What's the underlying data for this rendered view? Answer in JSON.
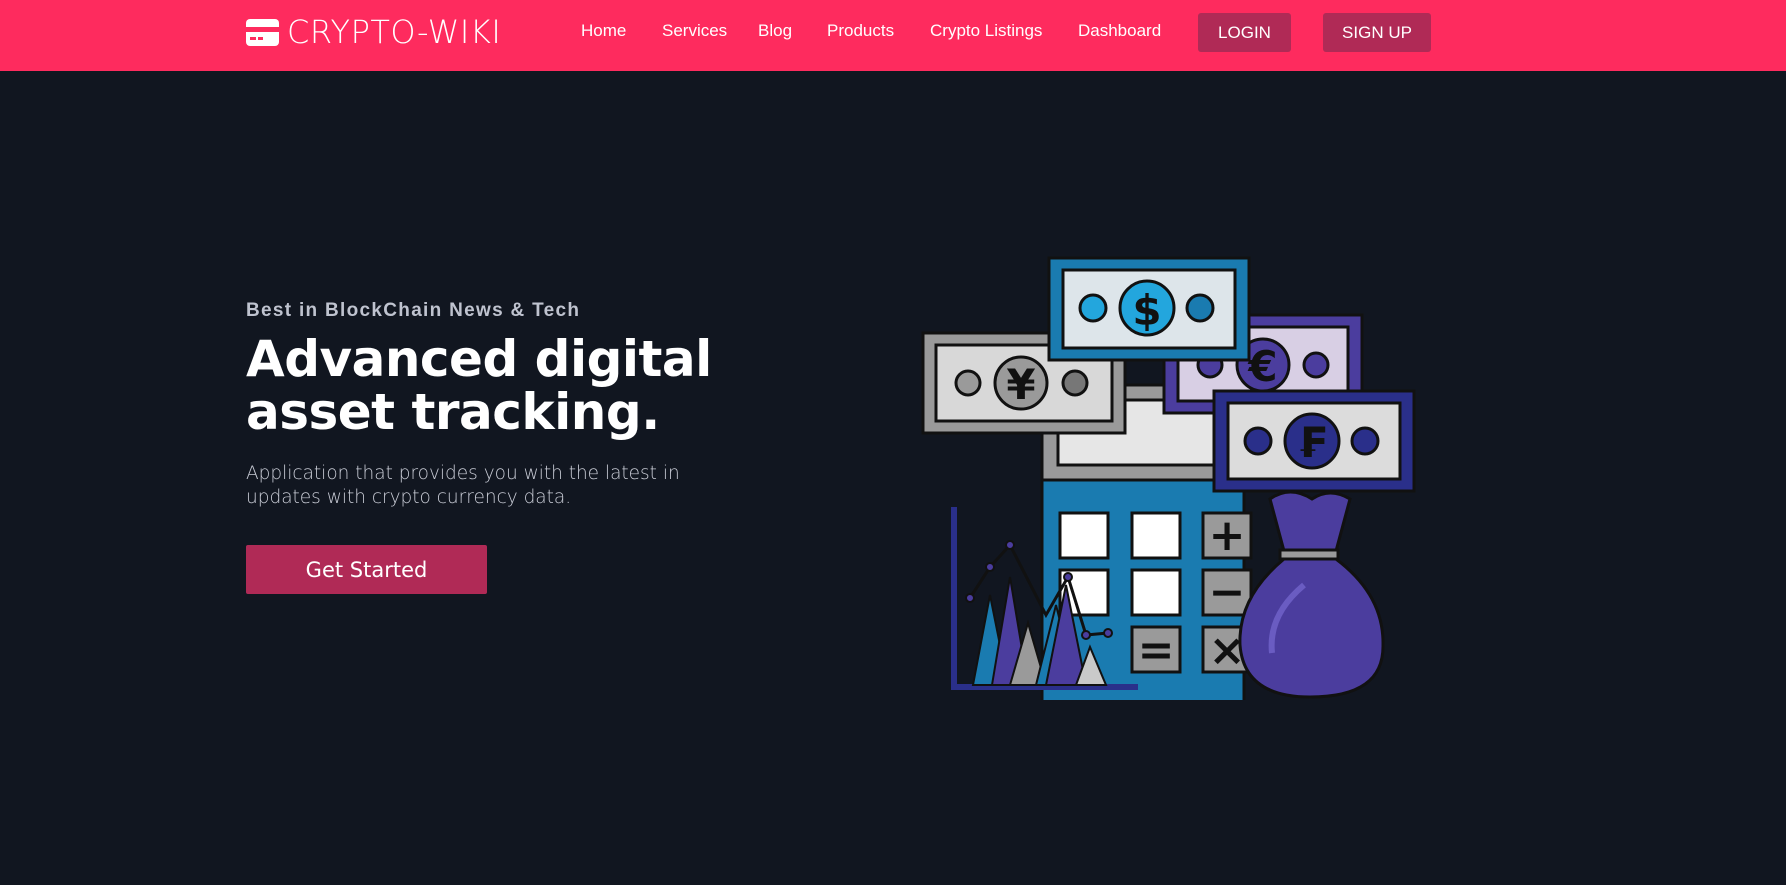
{
  "nav": {
    "brand": "CRYPTO-WIKI",
    "links": [
      "Home",
      "Services",
      "Blog",
      "Products",
      "Crypto Listings",
      "Dashboard"
    ],
    "login_label": "LOGIN",
    "signup_label": "SIGN UP"
  },
  "hero": {
    "eyebrow": "Best in BlockChain News & Tech",
    "headline": "Advanced digital asset tracking.",
    "subtext": "Application that provides you with the latest in updates with crypto currency data.",
    "cta_label": "Get Started"
  },
  "illustration": {
    "currency_symbols": [
      "¥",
      "$",
      "€",
      "₣"
    ],
    "keypad_symbols": [
      "+",
      "−",
      "=",
      "×"
    ]
  },
  "colors": {
    "navbar": "#fe2b5e",
    "button": "#b02a56",
    "background": "#111620"
  },
  "icons": {
    "brand": "credit-card-icon"
  }
}
